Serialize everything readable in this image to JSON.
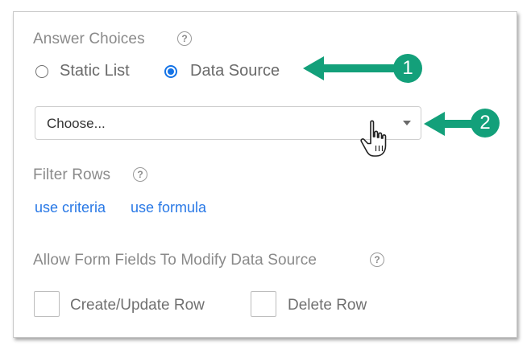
{
  "answer_choices": {
    "label": "Answer Choices",
    "help_icon": "question-circle-icon",
    "options": [
      {
        "label": "Static List",
        "selected": false
      },
      {
        "label": "Data Source",
        "selected": true
      }
    ]
  },
  "data_source_select": {
    "value": "Choose..."
  },
  "filter_rows": {
    "label": "Filter Rows",
    "links": [
      "use criteria",
      "use formula"
    ]
  },
  "modify": {
    "label": "Allow Form Fields To Modify Data Source",
    "checkboxes": [
      {
        "label": "Create/Update Row",
        "checked": false
      },
      {
        "label": "Delete Row",
        "checked": false
      }
    ]
  },
  "annotations": {
    "badge_1": "1",
    "badge_2": "2",
    "color": "#13a07a"
  },
  "colors": {
    "accent": "#1473e6",
    "link": "#2878e6"
  }
}
